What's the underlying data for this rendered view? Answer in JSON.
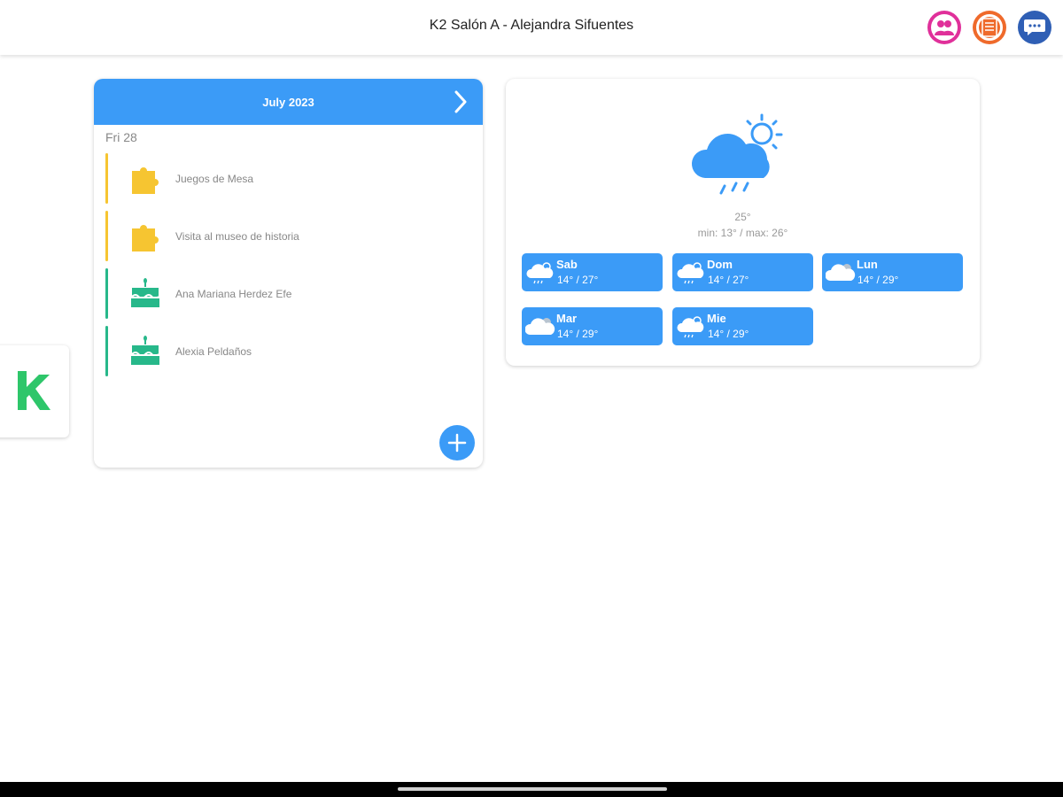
{
  "header": {
    "title": "K2 Salón A - Alejandra Sifuentes"
  },
  "header_icons": [
    {
      "icon": "people-icon",
      "color": "#e0309a"
    },
    {
      "icon": "document-icon",
      "color": "#ef6a2b"
    },
    {
      "icon": "chat-icon",
      "color": "#2f5fb5"
    }
  ],
  "side_tab": {
    "icon": "k-logo-icon",
    "color": "#2ec66a"
  },
  "calendar": {
    "month": "July 2023",
    "day": "Fri 28",
    "events": [
      {
        "name": "Juegos de Mesa",
        "icon": "puzzle-icon",
        "color": "#f6c531"
      },
      {
        "name": "Visita al museo de historia",
        "icon": "puzzle-icon",
        "color": "#f6c531"
      },
      {
        "name": "Ana Mariana Herdez Efe",
        "icon": "birthday-cake-icon",
        "color": "#27b88a"
      },
      {
        "name": "Alexia Peldaños",
        "icon": "birthday-cake-icon",
        "color": "#27b88a"
      }
    ]
  },
  "weather": {
    "current_icon": "sun-cloud-rain-icon",
    "temp": "25°",
    "range": "min: 13° / max: 26°",
    "forecast": [
      {
        "day": "Sab",
        "temp": "14° / 27°",
        "icon": "sun-cloud-rain-icon"
      },
      {
        "day": "Dom",
        "temp": "14° / 27°",
        "icon": "sun-cloud-rain-icon"
      },
      {
        "day": "Lun",
        "temp": "14° / 29°",
        "icon": "cloudy-icon"
      },
      {
        "day": "Mar",
        "temp": "14° / 29°",
        "icon": "cloudy-icon"
      },
      {
        "day": "Mie",
        "temp": "14° / 29°",
        "icon": "sun-cloud-rain-icon"
      }
    ]
  },
  "colors": {
    "accent": "#3b9bf7"
  }
}
